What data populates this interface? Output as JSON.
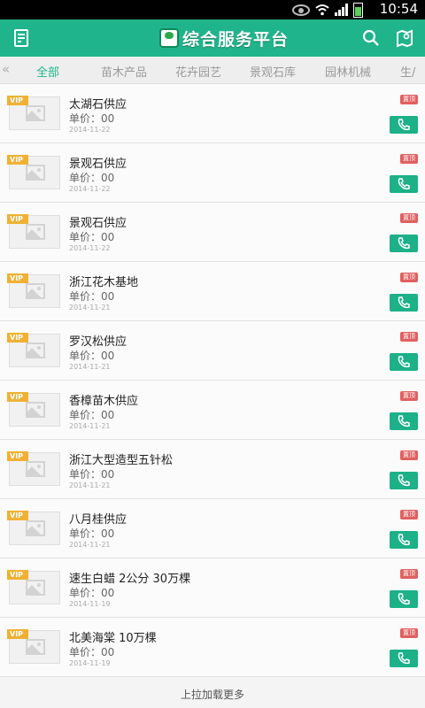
{
  "status_bar": {
    "time": "10:54"
  },
  "app_bar": {
    "title": "综合服务平台",
    "left_icon": "notepad-icon",
    "search_icon": "search-icon",
    "right_icon": "map-icon"
  },
  "tabs": {
    "left_arrow": "«",
    "items": [
      "全部",
      "苗木产品",
      "花卉园艺",
      "景观石库",
      "园林机械",
      "生/"
    ],
    "active_index": 0
  },
  "list": {
    "badge_label": "置顶",
    "vip_label": "VIP",
    "items": [
      {
        "title": "太湖石供应",
        "price": "单价：00",
        "date": "2014-11-22"
      },
      {
        "title": "景观石供应",
        "price": "单价：00",
        "date": "2014-11-22"
      },
      {
        "title": "景观石供应",
        "price": "单价：00",
        "date": "2014-11-22"
      },
      {
        "title": "浙江花木基地",
        "price": "单价：00",
        "date": "2014-11-21"
      },
      {
        "title": "罗汉松供应",
        "price": "单价：00",
        "date": "2014-11-21"
      },
      {
        "title": "香樟苗木供应",
        "price": "单价：00",
        "date": "2014-11-21"
      },
      {
        "title": "浙江大型造型五针松",
        "price": "单价：00",
        "date": "2014-11-21"
      },
      {
        "title": "八月桂供应",
        "price": "单价：00",
        "date": "2014-11-21"
      },
      {
        "title": "速生白蜡 2公分 30万棵",
        "price": "单价：00",
        "date": "2014-11-19"
      },
      {
        "title": "北美海棠 10万棵",
        "price": "单价：00",
        "date": "2014-11-19"
      }
    ]
  },
  "footer": {
    "load_more": "上拉加载更多"
  },
  "colors": {
    "primary": "#1fb48c",
    "vip": "#f0b133",
    "top_badge": "#e06060"
  }
}
